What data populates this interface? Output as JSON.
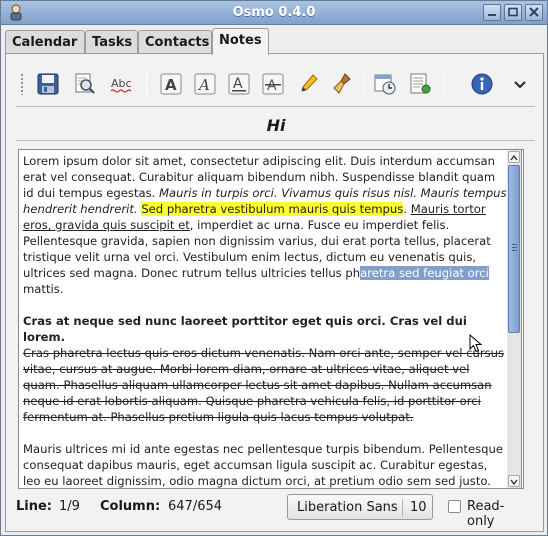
{
  "window": {
    "title": "Osmo 0.4.0"
  },
  "tabs": [
    {
      "label": "Calendar"
    },
    {
      "label": "Tasks"
    },
    {
      "label": "Contacts"
    },
    {
      "label": "Notes",
      "active": true
    }
  ],
  "toolbar": {
    "buttons": [
      {
        "icon": "save-icon"
      },
      {
        "icon": "find-icon"
      },
      {
        "icon": "spell-check-icon"
      },
      {
        "icon": "bold-icon"
      },
      {
        "icon": "italic-icon"
      },
      {
        "icon": "underline-icon"
      },
      {
        "icon": "strikethrough-icon"
      },
      {
        "icon": "highlight-pen-icon"
      },
      {
        "icon": "clear-format-brush-icon"
      },
      {
        "icon": "insert-date-icon"
      },
      {
        "icon": "word-count-icon"
      },
      {
        "icon": "info-icon"
      },
      {
        "icon": "chevron-down-icon"
      }
    ]
  },
  "note": {
    "title": "Hi",
    "p1": {
      "a": "Lorem ipsum dolor sit amet, consectetur adipiscing elit. Duis interdum accumsan erat vel consequat. Curabitur aliquam bibendum nibh. Suspendisse blandit quam id dui tempus egestas. ",
      "italic": "Mauris in turpis orci. Vivamus quis risus nisl. Mauris tempus hendrerit hendrerit.",
      "space": " ",
      "highlight": "Sed pharetra vestibulum mauris quis tempus",
      "b": ". ",
      "underline": "Mauris tortor eros, gravida quis suscipit et",
      "c": ", imperdiet ac urna. Fusce eu imperdiet felis. Pellentesque gravida, sapien non dignissim varius, dui erat porta tellus, placerat tristique velit urna vel orci. Vestibulum enim lectus, dictum eu venenatis quis, ultrices sed magna. Donec rutrum tellus ultricies tellus ph",
      "selected": "aretra sed feugiat orci ",
      "d": "mattis."
    },
    "p2": {
      "bold": "Cras at neque sed nunc laoreet porttitor eget quis orci. Cras vel dui lorem.",
      "strike": "Cras pharetra lectus quis eros dictum venenatis. Nam orci ante, semper vel cursus vitae, cursus at augue. Morbi lorem diam, ornare at ultrices vitae, aliquet vel quam. Phasellus aliquam ullamcorper lectus sit amet dapibus. Nullam accumsan neque id erat lobortis aliquam. Quisque pharetra vehicula felis, id porttitor orci fermentum at. Phasellus pretium ligula quis lacus tempus volutpat."
    },
    "p3": "Mauris ultrices mi id ante egestas nec pellentesque turpis bibendum. Pellentesque consequat dapibus mauris, eget accumsan ligula suscipit ac. Curabitur egestas, leo eu laoreet dignissim, odio magna dictum orci, at pretium odio sem sed justo. Donec dignissim rutrum ligula ut consequat. Pellentesque ornare, lacus quis eleifend"
  },
  "status": {
    "line_label": "Line:",
    "line_value": "1/9",
    "column_label": "Column:",
    "column_value": "647/654",
    "font_name": "Liberation Sans",
    "font_size": "10",
    "readonly_label": "Read-only",
    "readonly_checked": false
  },
  "colors": {
    "highlight": "#ffff2e",
    "selection": "#7f9fcf",
    "titlebar": "#8fb0d8"
  }
}
